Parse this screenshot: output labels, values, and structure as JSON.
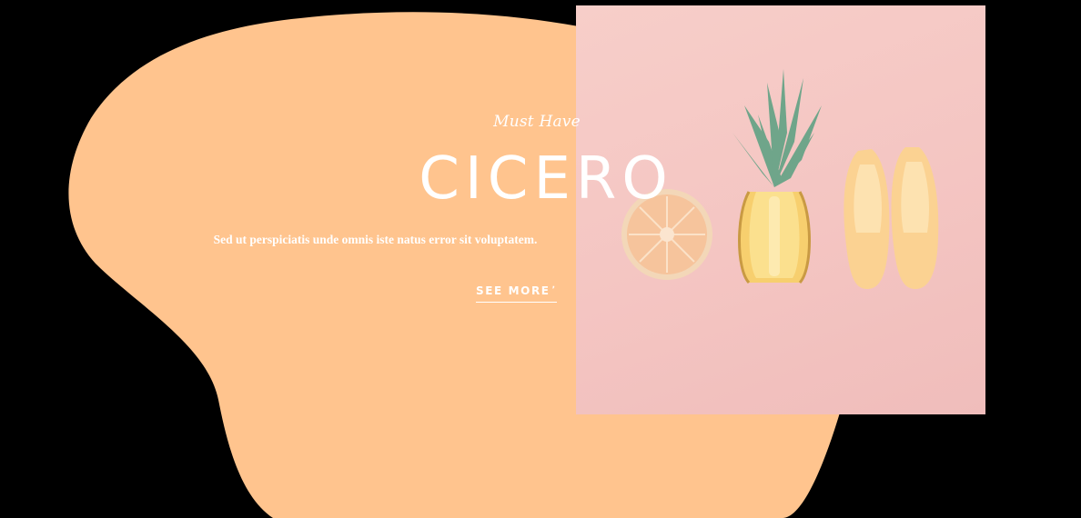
{
  "hero": {
    "eyebrow": "Must Have",
    "title": "CICERO",
    "subtitle": "Sed ut perspiciatis unde omnis iste natus error sit voluptatem.",
    "cta_label": "SEE MORE",
    "cta_arrow": "ʼ"
  },
  "colors": {
    "background": "#000000",
    "blob": "#ffc48e",
    "photo_bg": "#f5c8c4",
    "text": "#ffffff"
  },
  "image": {
    "subject_icons": [
      "grapefruit-slice-icon",
      "pineapple-half-icon",
      "yellow-flat-shoes-icon"
    ]
  }
}
